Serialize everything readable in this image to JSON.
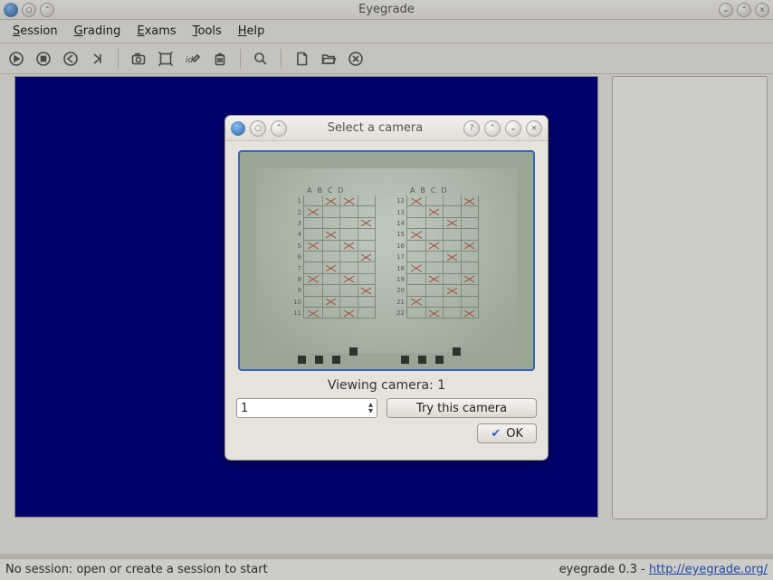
{
  "window": {
    "title": "Eyegrade"
  },
  "menus": {
    "session": {
      "label": "Session",
      "accel": "S"
    },
    "grading": {
      "label": "Grading",
      "accel": "G"
    },
    "exams": {
      "label": "Exams",
      "accel": "E"
    },
    "tools": {
      "label": "Tools",
      "accel": "T"
    },
    "help": {
      "label": "Help",
      "accel": "H"
    }
  },
  "status": {
    "left": "No session: open or create a session to start",
    "right_prefix": "eyegrade 0.3 - ",
    "link_text": "http://eyegrade.org/"
  },
  "modal": {
    "title": "Select a camera",
    "viewing_label": "Viewing camera: 1",
    "selected_camera": "1",
    "try_button": "Try this camera",
    "ok_button": "OK"
  },
  "preview_sheet": {
    "columns": [
      "A",
      "B",
      "C",
      "D"
    ],
    "left": {
      "rows": [
        1,
        2,
        3,
        4,
        5,
        6,
        7,
        8,
        9,
        10,
        11
      ],
      "marks": {
        "1": [
          "B",
          "C"
        ],
        "2": [
          "A"
        ],
        "3": [
          "D"
        ],
        "4": [
          "B"
        ],
        "5": [
          "A",
          "C"
        ],
        "6": [
          "D"
        ],
        "7": [
          "B"
        ],
        "8": [
          "A",
          "C"
        ],
        "9": [
          "D"
        ],
        "10": [
          "B"
        ],
        "11": [
          "A",
          "C"
        ]
      }
    },
    "right": {
      "rows": [
        12,
        13,
        14,
        15,
        16,
        17,
        18,
        19,
        20,
        21,
        22
      ],
      "marks": {
        "12": [
          "A",
          "D"
        ],
        "13": [
          "B"
        ],
        "14": [
          "C"
        ],
        "15": [
          "A"
        ],
        "16": [
          "B",
          "D"
        ],
        "17": [
          "C"
        ],
        "18": [
          "A"
        ],
        "19": [
          "B",
          "D"
        ],
        "20": [
          "C"
        ],
        "21": [
          "A"
        ],
        "22": [
          "B",
          "D"
        ]
      }
    }
  }
}
